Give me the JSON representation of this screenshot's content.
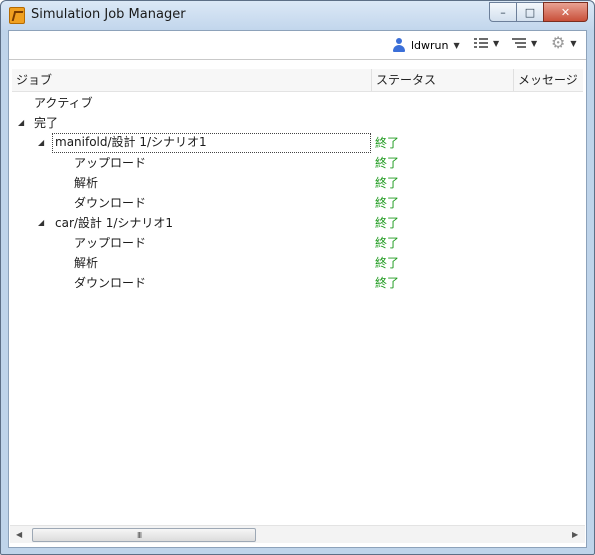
{
  "window": {
    "title": "Simulation Job Manager"
  },
  "title_buttons": {
    "minimize": "–",
    "maximize": "□",
    "close": "✕"
  },
  "toolbar": {
    "user_label": "ldwrun"
  },
  "columns": {
    "job": "ジョブ",
    "status": "ステータス",
    "message": "メッセージ"
  },
  "rows": [
    {
      "label": "アクティブ",
      "status": ""
    },
    {
      "label": "完了",
      "status": ""
    },
    {
      "label": "manifold/設計 1/シナリオ1",
      "status": "終了"
    },
    {
      "label": "アップロード",
      "status": "終了"
    },
    {
      "label": "解析",
      "status": "終了"
    },
    {
      "label": "ダウンロード",
      "status": "終了"
    },
    {
      "label": "car/設計 1/シナリオ1",
      "status": "終了"
    },
    {
      "label": "アップロード",
      "status": "終了"
    },
    {
      "label": "解析",
      "status": "終了"
    },
    {
      "label": "ダウンロード",
      "status": "終了"
    }
  ],
  "tree_arrow": "◢",
  "scrollbar": {
    "left_arrow": "◀",
    "right_arrow": "▶",
    "grip": "III"
  },
  "colors": {
    "status_ok": "#1e9a1e",
    "titlebar": "#c2d6ec"
  }
}
